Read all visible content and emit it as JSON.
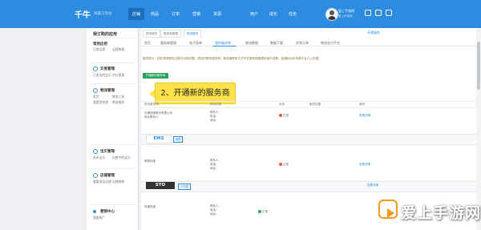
{
  "topbar": {
    "logo": "千牛",
    "logo_sub": "商家工作台",
    "nav": [
      "店铺",
      "商品",
      "订单",
      "营销",
      "货源",
      "用户",
      "成长",
      "任务"
    ],
    "user_name": "爱上手游网",
    "user_sub": "爱上手游网"
  },
  "sidebar": {
    "title": "我订购的应用",
    "groups": [
      {
        "head": "常用应用",
        "items": [
          "日常运营",
          "运营数据"
        ]
      },
      {
        "head": "交易管理",
        "items": [
          "已卖出的宝贝",
          "评价管理"
        ]
      },
      {
        "head": "物流管理",
        "items": [
          "发货",
          "物流工具",
          "我要寄快递",
          "物流服务"
        ]
      },
      {
        "head": "宝贝管理",
        "items": [
          "发布宝贝",
          "出售中的宝贝"
        ]
      },
      {
        "head": "店铺管理",
        "items": [
          "查看淘宝店铺",
          "店铺装修"
        ]
      },
      {
        "head": "营销中心",
        "items": [
          "我要推广"
        ]
      }
    ]
  },
  "breadcrumb": {
    "tabs": [
      "物流服务",
      "服务商管理",
      "物流服务"
    ],
    "right_link": "开通服务"
  },
  "tabs": [
    "首页",
    "服务商管理",
    "电子面单",
    "我的服务商",
    "物流数据",
    "数据下载",
    "异常订单",
    "物流支付平台"
  ],
  "active_tab": "我的服务商",
  "notice": "服务提示：如在物流服务过程中出现问题，请及时联系服务商，服务商联系方式可在服务商管理页面中查看，如遇纠纷可申请平台介入处理。",
  "open_button": "开通新的服务商",
  "callout": "2、开通新的服务商",
  "table_headers": [
    "物流服务商",
    "网点信息",
    "状态",
    "服务范围",
    "操作"
  ],
  "rows": [
    {
      "name": "中通快递股份有限公司",
      "sub": "网点联系人",
      "contact": "联系人：",
      "phone": "电话：",
      "addr": "地址：",
      "status": "正常",
      "status_color": "#e25b3a",
      "scope": "",
      "action": "查看详情"
    },
    {
      "name": "邮政快递",
      "sub": "",
      "contact": "联系人：",
      "phone": "电话：",
      "addr": "地址：",
      "status": "正常",
      "status_color": "#e25b3a",
      "scope": "",
      "action": "查看详情"
    },
    {
      "name": "申通快递",
      "sub": "",
      "contact": "联系人：",
      "phone": "电话：",
      "addr": "地址：",
      "status": "正常",
      "status_color": "#27a15d",
      "scope": "",
      "action": "查看详情"
    }
  ],
  "brands": [
    {
      "name": "EMS",
      "tag": "推荐",
      "color": "#2d8ce0"
    },
    {
      "name": "STO",
      "tag": "已开通",
      "color": "#333333"
    }
  ],
  "watermark": "爱上手游网"
}
